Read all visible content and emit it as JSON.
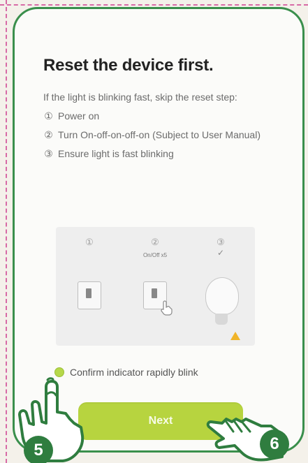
{
  "screen": {
    "title": "Reset the device first.",
    "intro": "If the light is blinking fast, skip the reset step:",
    "steps": [
      {
        "num": "①",
        "text": "Power on"
      },
      {
        "num": "②",
        "text": "Turn On-off-on-off-on (Subject to User Manual)"
      },
      {
        "num": "③",
        "text": "Ensure light is fast blinking"
      }
    ]
  },
  "illustration": {
    "panel_labels": [
      "①",
      "②",
      "③"
    ],
    "panel_2_caption": "On/Off x5",
    "checkmark": "✓"
  },
  "confirm": {
    "label": "Confirm indicator rapidly blink",
    "selected": true
  },
  "actions": {
    "next_label": "Next"
  },
  "callouts": {
    "badge_5": "5",
    "badge_6": "6"
  },
  "colors": {
    "card_border": "#3a8f4c",
    "button_bg": "#b7d43f",
    "badge_bg": "#2f7d3f",
    "dashed_guide": "#d76aa6"
  }
}
